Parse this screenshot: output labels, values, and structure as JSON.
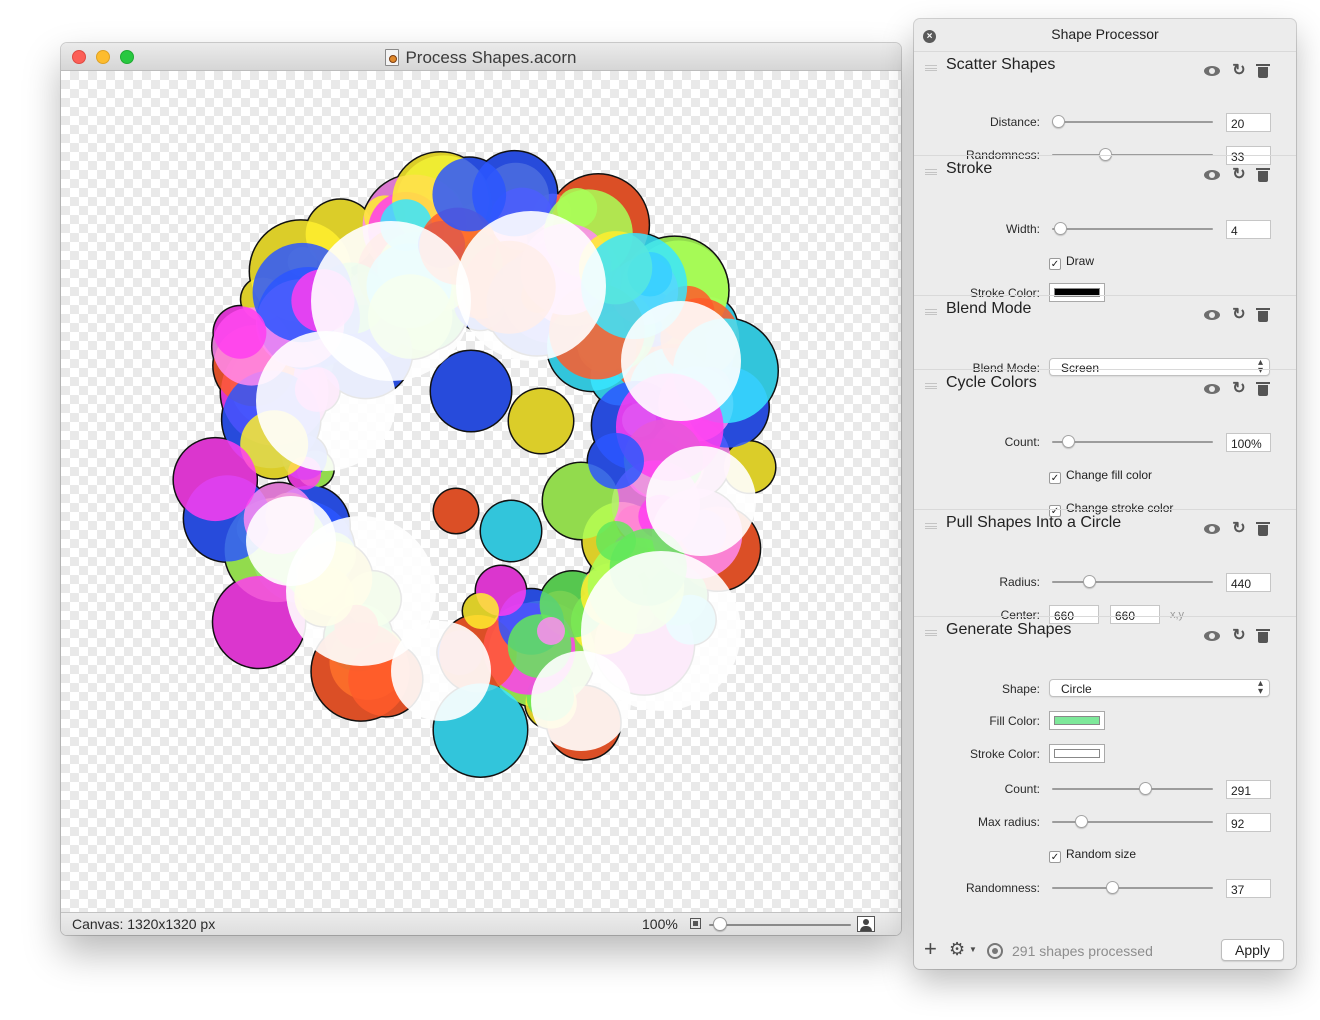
{
  "document": {
    "title": "Process Shapes.acorn",
    "canvas_size": "Canvas: 1320x1320 px",
    "zoom": "100%",
    "zoom_level": 0.05
  },
  "panel": {
    "title": "Shape Processor",
    "sections": {
      "scatter": {
        "title": "Scatter Shapes",
        "distance_label": "Distance:",
        "distance": "20",
        "distance_level": 0.04,
        "randomness_label": "Randomness:",
        "randomness": "33",
        "randomness_level": 0.33
      },
      "stroke": {
        "title": "Stroke",
        "width_label": "Width:",
        "width": "4",
        "width_level": 0.05,
        "draw_label": "Draw",
        "stroke_color_label": "Stroke Color:",
        "stroke_color": "#000000"
      },
      "blend": {
        "title": "Blend Mode",
        "mode_label": "Blend Mode:",
        "mode": "Screen"
      },
      "cycle": {
        "title": "Cycle Colors",
        "count_label": "Count:",
        "count": "100%",
        "count_level": 0.1,
        "change_fill_label": "Change fill color",
        "change_stroke_label": "Change stroke color"
      },
      "pull": {
        "title": "Pull Shapes Into a Circle",
        "radius_label": "Radius:",
        "radius": "440",
        "radius_level": 0.23,
        "center_label": "Center:",
        "center_x": "660",
        "center_y": "660",
        "xy_hint": "x,y"
      },
      "generate": {
        "title": "Generate Shapes",
        "shape_label": "Shape:",
        "shape": "Circle",
        "fill_color_label": "Fill Color:",
        "fill_color": "#7ee89a",
        "stroke_color_label": "Stroke Color:",
        "stroke_color": "#ffffff",
        "count_label": "Count:",
        "count": "291",
        "count_level": 0.58,
        "max_radius_label": "Max radius:",
        "max_radius": "92",
        "max_radius_level": 0.18,
        "random_size_label": "Random size",
        "randomness_label": "Randomness:",
        "randomness": "37",
        "randomness_level": 0.37
      }
    },
    "footer": {
      "status": "291 shapes processed",
      "apply": "Apply"
    }
  },
  "colors": {
    "bubble_palette": [
      "#ff3df0",
      "#ffef2e",
      "#38e5ff",
      "#63e85a",
      "#2b56ff",
      "#ff5a2a",
      "#ff8bf2",
      "#a9ff58",
      "#ffffff"
    ]
  }
}
